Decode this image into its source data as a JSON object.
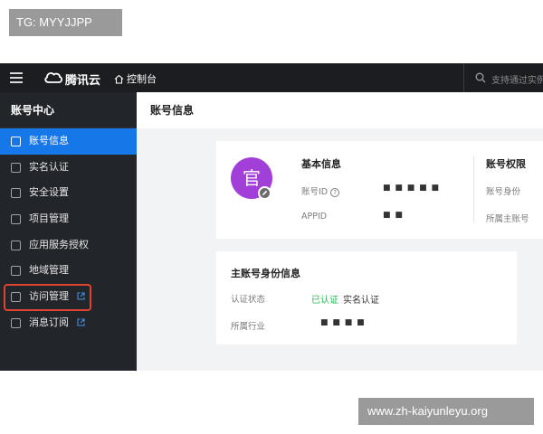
{
  "watermarks": {
    "top_left": "TG: MYYJJPP",
    "bottom_right": "www.zh-kaiyunleyu.org"
  },
  "topbar": {
    "brand": "腾讯云",
    "console": "控制台",
    "search_placeholder": "支持通过实例"
  },
  "sidebar": {
    "title": "账号中心",
    "items": [
      {
        "label": "账号信息",
        "icon": "user-icon",
        "active": true,
        "external": false
      },
      {
        "label": "实名认证",
        "icon": "id-card-icon",
        "active": false,
        "external": false
      },
      {
        "label": "安全设置",
        "icon": "shield-icon",
        "active": false,
        "external": false
      },
      {
        "label": "项目管理",
        "icon": "project-icon",
        "active": false,
        "external": false
      },
      {
        "label": "应用服务授权",
        "icon": "layers-icon",
        "active": false,
        "external": false
      },
      {
        "label": "地域管理",
        "icon": "map-icon",
        "active": false,
        "external": false
      },
      {
        "label": "访问管理",
        "icon": "access-icon",
        "active": false,
        "external": true,
        "highlighted": true
      },
      {
        "label": "消息订阅",
        "icon": "bell-icon",
        "active": false,
        "external": true
      }
    ]
  },
  "main": {
    "page_title": "账号信息",
    "basic": {
      "avatar_char": "官",
      "section_title": "基本信息",
      "account_id_label": "账号ID",
      "account_id_value": "■ ■ ■ ■ ■",
      "appid_label": "APPID",
      "appid_value": "■ ■",
      "permissions_title": "账号权限",
      "identity_label": "账号身份",
      "owner_label": "所属主账号"
    },
    "identity": {
      "section_title": "主账号身份信息",
      "auth_status_label": "认证状态",
      "auth_status_ok": "已认证",
      "auth_status_value": "实名认证",
      "industry_label": "所属行业",
      "industry_value": "■ ■ ■ ■"
    }
  },
  "colors": {
    "accent": "#1677e8",
    "topbar": "#1b1d21",
    "sidebar": "#22252a",
    "avatar": "#a23fd9",
    "success": "#2cb35a",
    "highlight": "#e0432e"
  }
}
